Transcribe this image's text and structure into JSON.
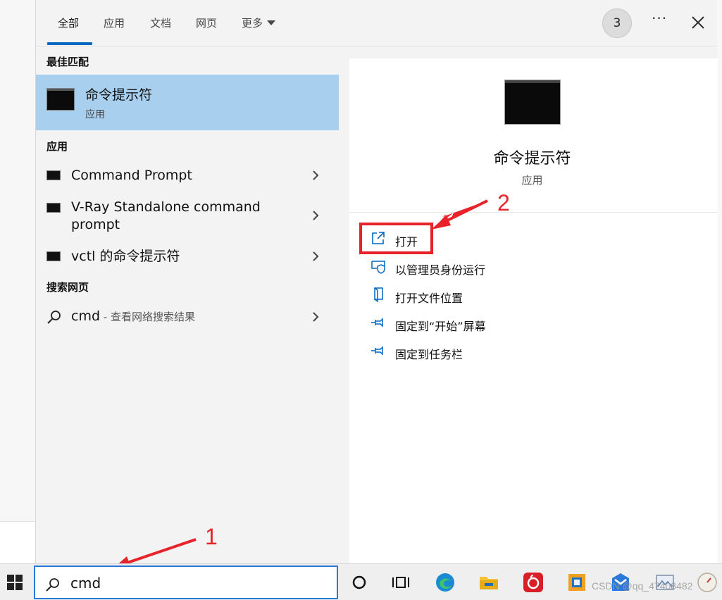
{
  "tabs": {
    "all": "全部",
    "apps": "应用",
    "docs": "文档",
    "web": "网页",
    "more": "更多",
    "badge": "3",
    "more_menu": "···"
  },
  "left": {
    "best_match_label": "最佳匹配",
    "best_match": {
      "title": "命令提示符",
      "subtitle": "应用"
    },
    "apps_label": "应用",
    "apps": [
      {
        "line1": "Command Prompt",
        "line2": ""
      },
      {
        "line1": "V-Ray Standalone command",
        "line2": "prompt"
      },
      {
        "line1": "vctl 的命令提示符",
        "line2": ""
      }
    ],
    "web_label": "搜索网页",
    "web": {
      "query": "cmd",
      "suffix": " - 查看网络搜索结果"
    }
  },
  "detail": {
    "title": "命令提示符",
    "subtitle": "应用",
    "actions": [
      {
        "label": "打开",
        "icon": "open-icon"
      },
      {
        "label": "以管理员身份运行",
        "icon": "shield-icon"
      },
      {
        "label": "打开文件位置",
        "icon": "folder-icon"
      },
      {
        "label": "固定到“开始”屏幕",
        "icon": "pin-icon"
      },
      {
        "label": "固定到任务栏",
        "icon": "pin-icon"
      }
    ]
  },
  "annotations": {
    "step1": "1",
    "step2": "2"
  },
  "taskbar": {
    "search_value": "cmd",
    "watermark": "CSDN @qq_47408482"
  },
  "colors": {
    "accent": "#0067c0",
    "selection": "#a9cfee",
    "annotation": "#e7222a"
  }
}
